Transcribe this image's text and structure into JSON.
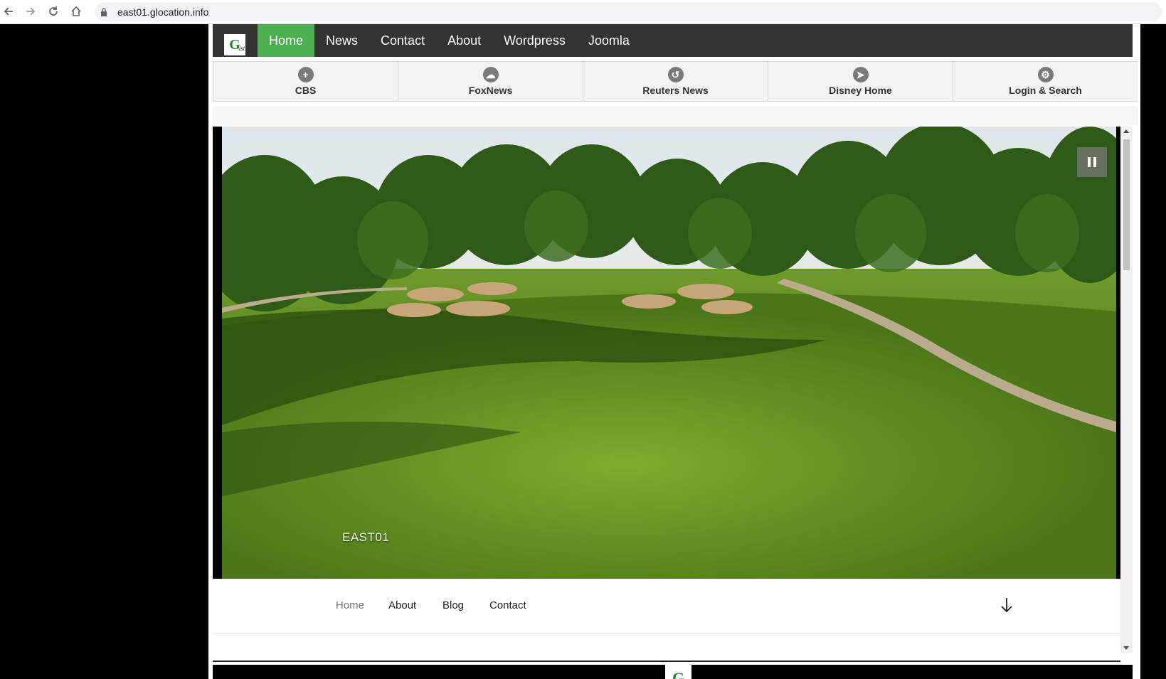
{
  "browser": {
    "url": "east01.glocation.info"
  },
  "logo": {
    "letter": "G",
    "suffix": "ist"
  },
  "top_nav": [
    {
      "label": "Home",
      "active": true
    },
    {
      "label": "News",
      "active": false
    },
    {
      "label": "Contact",
      "active": false
    },
    {
      "label": "About",
      "active": false
    },
    {
      "label": "Wordpress",
      "active": false
    },
    {
      "label": "Joomla",
      "active": false
    }
  ],
  "icon_bar": [
    {
      "label": "CBS",
      "icon": "plus-circle-icon",
      "glyph": "+"
    },
    {
      "label": "FoxNews",
      "icon": "cloud-icon",
      "glyph": "☁"
    },
    {
      "label": "Reuters News",
      "icon": "refresh-icon",
      "glyph": "↺"
    },
    {
      "label": "Disney Home",
      "icon": "location-arrow-icon",
      "glyph": "➤"
    },
    {
      "label": "Login & Search",
      "icon": "gear-icon",
      "glyph": "⚙"
    }
  ],
  "hero": {
    "site_title": "EAST01"
  },
  "sub_nav": [
    {
      "label": "Home",
      "current": true
    },
    {
      "label": "About",
      "current": false
    },
    {
      "label": "Blog",
      "current": false
    },
    {
      "label": "Contact",
      "current": false
    }
  ],
  "colors": {
    "topnav_bg": "#333333",
    "active_tab": "#4caf50",
    "logo_green": "#1a8a2a"
  }
}
